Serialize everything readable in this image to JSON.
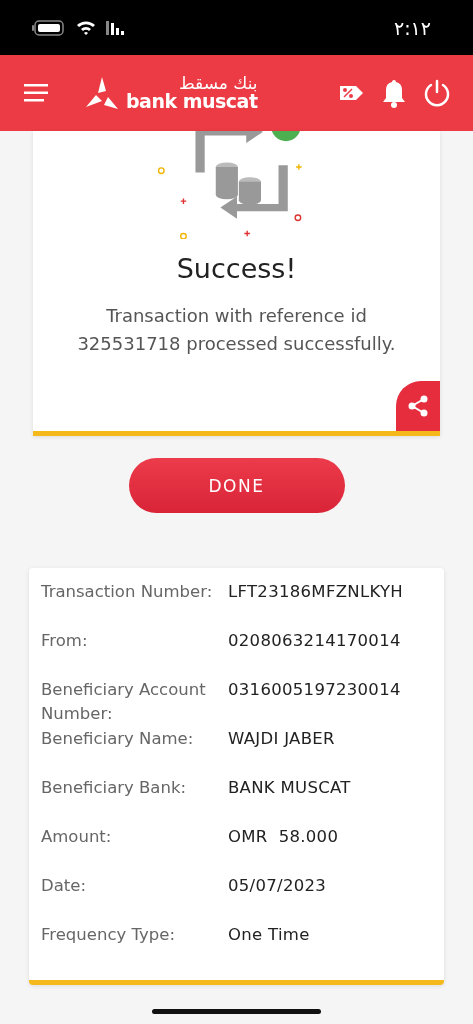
{
  "status_bar": {
    "time": "٢:١٢"
  },
  "header": {
    "logo_arabic": "بنك مسقط",
    "logo_latin": "bank muscat"
  },
  "result": {
    "title": "Success!",
    "message": "Transaction with reference id 325531718 processed successfully."
  },
  "done_button": "DONE",
  "details": [
    {
      "label": "Transaction Number:",
      "value": "LFT23186MFZNLKYH"
    },
    {
      "label": "From:",
      "value": "0208063214170014"
    },
    {
      "label": "Beneficiary Account Number:",
      "value": "0316005197230014"
    },
    {
      "label": "Beneficiary Name:",
      "value": "WAJDI JABER"
    },
    {
      "label": "Beneficiary Bank:",
      "value": "BANK MUSCAT"
    },
    {
      "label": "Amount:",
      "value": "OMR  58.000"
    },
    {
      "label": "Date:",
      "value": "05/07/2023"
    },
    {
      "label": "Frequency Type:",
      "value": "One Time"
    }
  ]
}
